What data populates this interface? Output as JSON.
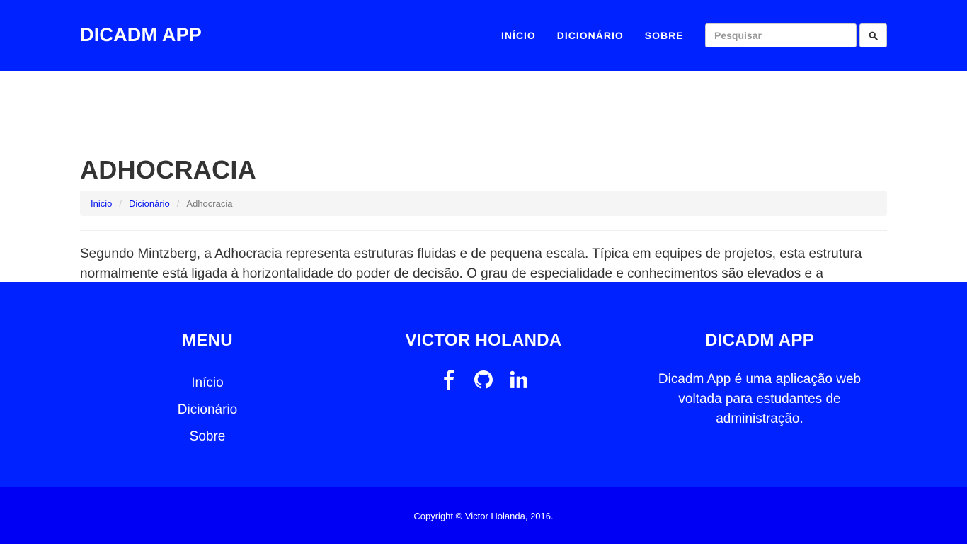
{
  "navbar": {
    "brand": "DICADM APP",
    "links": [
      {
        "label": "INÍCIO"
      },
      {
        "label": "DICIONÁRIO"
      },
      {
        "label": "SOBRE"
      }
    ],
    "search": {
      "placeholder": "Pesquisar",
      "value": "",
      "button_icon": "search-icon"
    },
    "background_color": "#0022ff"
  },
  "main": {
    "title": "ADHOCRACIA",
    "breadcrumb": [
      {
        "label": "Inicio"
      },
      {
        "label": "Dicionário"
      },
      {
        "label": "Adhocracia"
      }
    ],
    "description": "Segundo Mintzberg, a Adhocracia representa estruturas fluidas e de pequena escala. Típica em equipes de projetos, esta estrutura normalmente está ligada à horizontalidade do poder de decisão. O grau de especialidade e conhecimentos são elevados e a informalidade é uma forte característica. As principais vantagens desta estrutura são a reduzida burocracia e a rapidez no processo decisório. Parte chave da organização: Assessoria de Apoio."
  },
  "footer": {
    "menu": {
      "heading": "MENU",
      "links": [
        {
          "label": "Início"
        },
        {
          "label": "Dicionário"
        },
        {
          "label": "Sobre"
        }
      ]
    },
    "author": {
      "heading": "VICTOR HOLANDA",
      "social_icons": [
        "facebook-icon",
        "github-icon",
        "linkedin-icon"
      ]
    },
    "about": {
      "heading": "DICADM APP",
      "text": "Dicadm App é uma aplicação web voltada para estudantes de administração."
    },
    "copyright": "Copyright © Victor Holanda, 2016.",
    "background_color": "#0022ff",
    "copyright_bar_color": "#0000f5"
  }
}
